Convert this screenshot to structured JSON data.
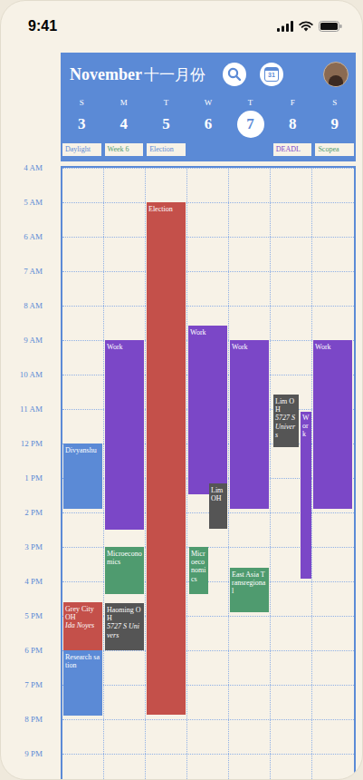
{
  "status_bar": {
    "time": "9:41"
  },
  "header": {
    "month": "November",
    "month_cn": "十一月份",
    "calendar_icon_text": "31"
  },
  "days": [
    {
      "letter": "S",
      "date": "3",
      "selected": false
    },
    {
      "letter": "M",
      "date": "4",
      "selected": false
    },
    {
      "letter": "T",
      "date": "5",
      "selected": false
    },
    {
      "letter": "W",
      "date": "6",
      "selected": false
    },
    {
      "letter": "T",
      "date": "7",
      "selected": true
    },
    {
      "letter": "F",
      "date": "8",
      "selected": false
    },
    {
      "letter": "S",
      "date": "9",
      "selected": false
    }
  ],
  "all_day": [
    {
      "label": "Daylight",
      "day": 0,
      "color": "#5b8ad6"
    },
    {
      "label": "Week 6",
      "day": 1,
      "color": "#4f9b6f"
    },
    {
      "label": "Election",
      "day": 2,
      "color": "#5b8ad6"
    },
    {
      "label": "DEADL",
      "day": 5,
      "color": "#7b47c7"
    },
    {
      "label": "Scopea",
      "day": 6,
      "color": "#4f9b6f"
    }
  ],
  "hours": [
    "4 AM",
    "5 AM",
    "6 AM",
    "7 AM",
    "8 AM",
    "9 AM",
    "10 AM",
    "11 AM",
    "12 PM",
    "1 PM",
    "2 PM",
    "3 PM",
    "4 PM",
    "5 PM",
    "6 PM",
    "7 PM",
    "8 PM",
    "9 PM"
  ],
  "events": [
    {
      "day": 0,
      "title": "Divyanshu",
      "start": 12.0,
      "end": 13.9,
      "lane": "full",
      "color": "#5b8ad6"
    },
    {
      "day": 0,
      "title": "Grey City OH",
      "subtitle": "Ida Noyes",
      "start": 16.6,
      "end": 18.5,
      "lane": "full",
      "color": "#c4504a"
    },
    {
      "day": 0,
      "title": "Research sation",
      "start": 18.0,
      "end": 19.9,
      "lane": "full",
      "color": "#5b8ad6"
    },
    {
      "day": 1,
      "title": "Work",
      "start": 9.0,
      "end": 14.5,
      "lane": "full",
      "color": "#7b47c7"
    },
    {
      "day": 1,
      "title": "Microeconomics",
      "start": 15.0,
      "end": 16.37,
      "lane": "full",
      "color": "#4f9b6f"
    },
    {
      "day": 1,
      "title": "Haoming OH",
      "subtitle": "5727 S Univers",
      "start": 16.63,
      "end": 18.0,
      "lane": "full",
      "color": "#555555"
    },
    {
      "day": 2,
      "title": "Election",
      "start": 5.0,
      "end": 19.87,
      "lane": "full",
      "color": "#c4504a"
    },
    {
      "day": 3,
      "title": "Work",
      "start": 8.58,
      "end": 13.47,
      "lane": "full",
      "color": "#7b47c7"
    },
    {
      "day": 3,
      "title": "Lim OH",
      "start": 13.16,
      "end": 14.47,
      "lane": "right",
      "color": "#555555"
    },
    {
      "day": 3,
      "title": "Microeconomics",
      "start": 15.0,
      "end": 16.37,
      "lane": "left",
      "color": "#4f9b6f"
    },
    {
      "day": 4,
      "title": "Work",
      "start": 9.0,
      "end": 13.9,
      "lane": "full",
      "color": "#7b47c7"
    },
    {
      "day": 4,
      "title": "East Asia Transregional",
      "start": 15.6,
      "end": 16.9,
      "lane": "full",
      "color": "#4f9b6f"
    },
    {
      "day": 5,
      "title": "Lim OH",
      "subtitle": "5727 S Univers",
      "start": 10.58,
      "end": 12.1,
      "lane": "main",
      "color": "#555555"
    },
    {
      "day": 5,
      "title": "Work",
      "start": 11.08,
      "end": 15.92,
      "lane": "side",
      "color": "#7b47c7"
    },
    {
      "day": 6,
      "title": "Work",
      "start": 9.0,
      "end": 13.9,
      "lane": "full",
      "color": "#7b47c7"
    }
  ]
}
